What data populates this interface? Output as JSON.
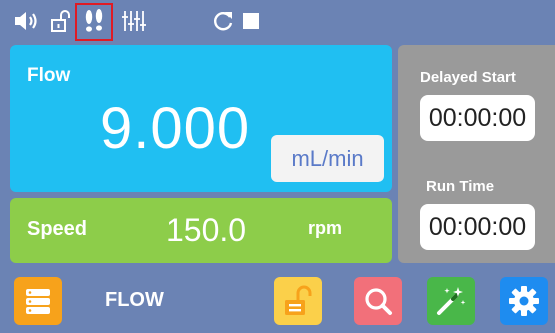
{
  "status_bar": {
    "icons": [
      "speaker-icon",
      "unlocked-icon",
      "footprints-icon",
      "equalizer-icon",
      "refresh-icon",
      "stop-square-icon"
    ],
    "highlight_color": "#e01b24"
  },
  "flow": {
    "label": "Flow",
    "value": "9.000",
    "unit": "mL/min",
    "color": "#20bff2"
  },
  "speed": {
    "label": "Speed",
    "value": "150.0",
    "unit": "rpm",
    "color": "#8dcd4a"
  },
  "delayed_start": {
    "label": "Delayed Start",
    "value": "00:00:00"
  },
  "run_time": {
    "label": "Run Time",
    "value": "00:00:00"
  },
  "bottom_bar": {
    "mode_label": "FLOW",
    "buttons": [
      {
        "icon": "list-menu-icon",
        "color": "#f7a21b"
      },
      {
        "icon": "unlock-icon",
        "color": "#fbd04a"
      },
      {
        "icon": "search-icon",
        "color": "#f2707a"
      },
      {
        "icon": "magic-wand-icon",
        "color": "#49b749"
      },
      {
        "icon": "settings-gear-icon",
        "color": "#1e8cf0"
      }
    ]
  }
}
